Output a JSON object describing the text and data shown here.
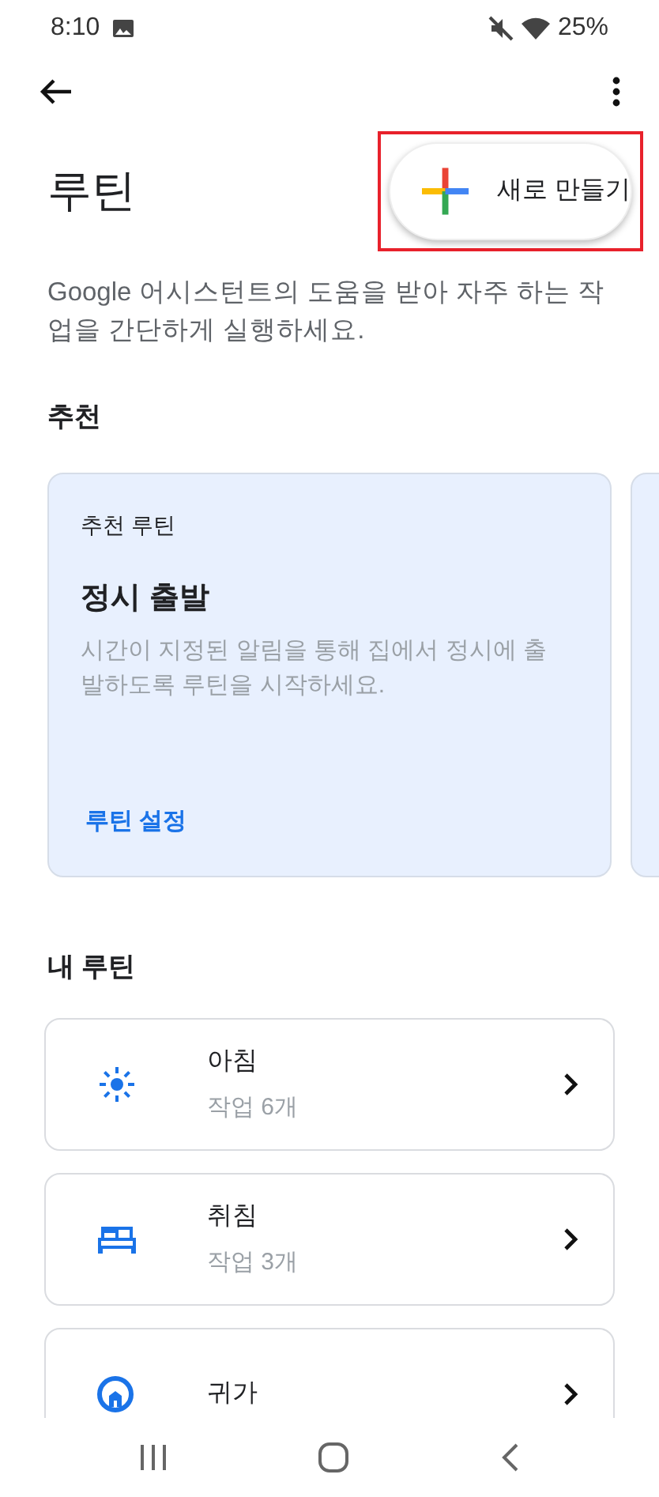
{
  "status_bar": {
    "time": "8:10",
    "battery": "25%"
  },
  "header": {
    "title": "루틴",
    "new_button": "새로 만들기",
    "highlighted": true,
    "description": "Google 어시스턴트의 도움을 받아 자주 하는 작업을 간단하게 실행하세요."
  },
  "recommended": {
    "heading": "추천",
    "cards": [
      {
        "label": "추천 루틴",
        "title": "정시 출발",
        "text": "시간이 지정된 알림을 통해 집에서 정시에 출발하도록 루틴을 시작하세요.",
        "action": "루틴 설정"
      }
    ]
  },
  "my_routines": {
    "heading": "내 루틴",
    "items": [
      {
        "kind": "sun",
        "title": "아침",
        "subtitle": "작업 6개"
      },
      {
        "kind": "bed",
        "title": "취침",
        "subtitle": "작업 3개"
      },
      {
        "kind": "home",
        "title": "귀가"
      }
    ]
  }
}
